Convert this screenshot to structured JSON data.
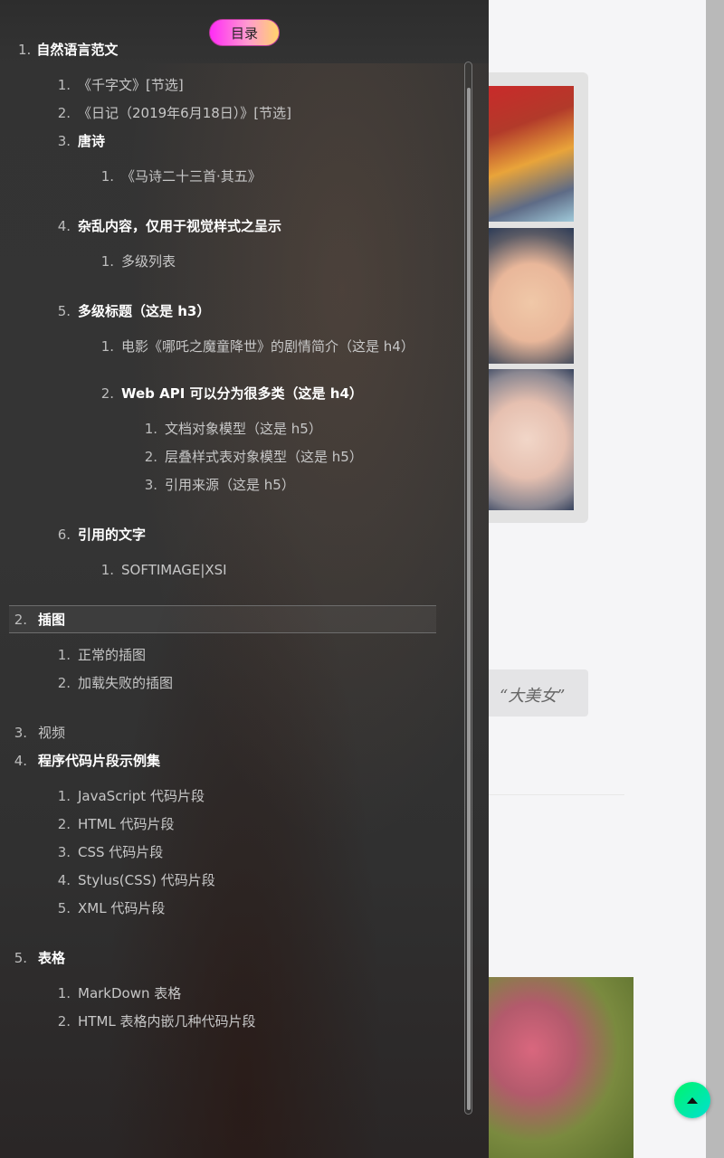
{
  "toc_button_label": "目录",
  "quote_text": "“大美女”",
  "clipped_heading": {
    "num": "1.",
    "label": "自然语言范文"
  },
  "toc": {
    "s1_1": {
      "num": "1.",
      "label": "《千字文》[节选]"
    },
    "s1_2": {
      "num": "2.",
      "label": "《日记（2019年6月18日）》[节选]"
    },
    "s1_3": {
      "num": "3.",
      "label": "唐诗"
    },
    "s1_3_1": {
      "num": "1.",
      "label": "《马诗二十三首·其五》"
    },
    "s1_4": {
      "num": "4.",
      "label": "杂乱内容，仅用于视觉样式之呈示"
    },
    "s1_4_1": {
      "num": "1.",
      "label": "多级列表"
    },
    "s1_5": {
      "num": "5.",
      "label": "多级标题（这是 h3）"
    },
    "s1_5_1": {
      "num": "1.",
      "label": "电影《哪吒之魔童降世》的剧情简介（这是 h4）"
    },
    "s1_5_2": {
      "num": "2.",
      "label": "Web API 可以分为很多类（这是 h4）"
    },
    "s1_5_2_1": {
      "num": "1.",
      "label": "文档对象模型（这是 h5）"
    },
    "s1_5_2_2": {
      "num": "2.",
      "label": "层叠样式表对象模型（这是 h5）"
    },
    "s1_5_2_3": {
      "num": "3.",
      "label": "引用来源（这是 h5）"
    },
    "s1_6": {
      "num": "6.",
      "label": "引用的文字"
    },
    "s1_6_1": {
      "num": "1.",
      "label": "SOFTIMAGE|XSI"
    },
    "s2": {
      "num": "2.",
      "label": "插图"
    },
    "s2_1": {
      "num": "1.",
      "label": "正常的插图"
    },
    "s2_2": {
      "num": "2.",
      "label": "加载失败的插图"
    },
    "s3": {
      "num": "3.",
      "label": "视频"
    },
    "s4": {
      "num": "4.",
      "label": "程序代码片段示例集"
    },
    "s4_1": {
      "num": "1.",
      "label": "JavaScript 代码片段"
    },
    "s4_2": {
      "num": "2.",
      "label": "HTML 代码片段"
    },
    "s4_3": {
      "num": "3.",
      "label": "CSS 代码片段"
    },
    "s4_4": {
      "num": "4.",
      "label": "Stylus(CSS) 代码片段"
    },
    "s4_5": {
      "num": "5.",
      "label": "XML 代码片段"
    },
    "s5": {
      "num": "5.",
      "label": "表格"
    },
    "s5_1": {
      "num": "1.",
      "label": "MarkDown 表格"
    },
    "s5_2": {
      "num": "2.",
      "label": "HTML 表格内嵌几种代码片段"
    }
  },
  "colors": {
    "toc_bg": "#333333",
    "back_to_top": "#00f56a",
    "toc_button": "#ff2bf6"
  },
  "icons": {
    "back_to_top": "caret-up-icon"
  }
}
